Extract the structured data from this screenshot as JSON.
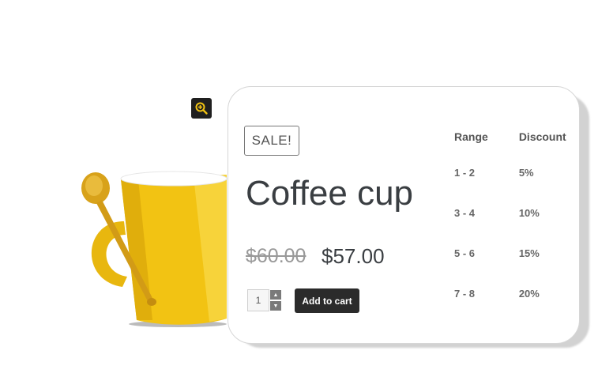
{
  "icons": {
    "zoom": "zoom-in-icon",
    "product": "coffee-mug-image"
  },
  "colors": {
    "mug": "#f2c313",
    "button": "#2b2b2b",
    "text": "#3a3e42"
  },
  "product": {
    "badge": "SALE!",
    "title": "Coffee cup",
    "old_price": "$60.00",
    "new_price": "$57.00",
    "quantity": "1",
    "add_to_cart": "Add to cart"
  },
  "tiers": {
    "headers": {
      "range": "Range",
      "discount": "Discount"
    },
    "rows": [
      {
        "range": "1 - 2",
        "discount": "5%"
      },
      {
        "range": "3 - 4",
        "discount": "10%"
      },
      {
        "range": "5 - 6",
        "discount": "15%"
      },
      {
        "range": "7 - 8",
        "discount": "20%"
      }
    ]
  }
}
